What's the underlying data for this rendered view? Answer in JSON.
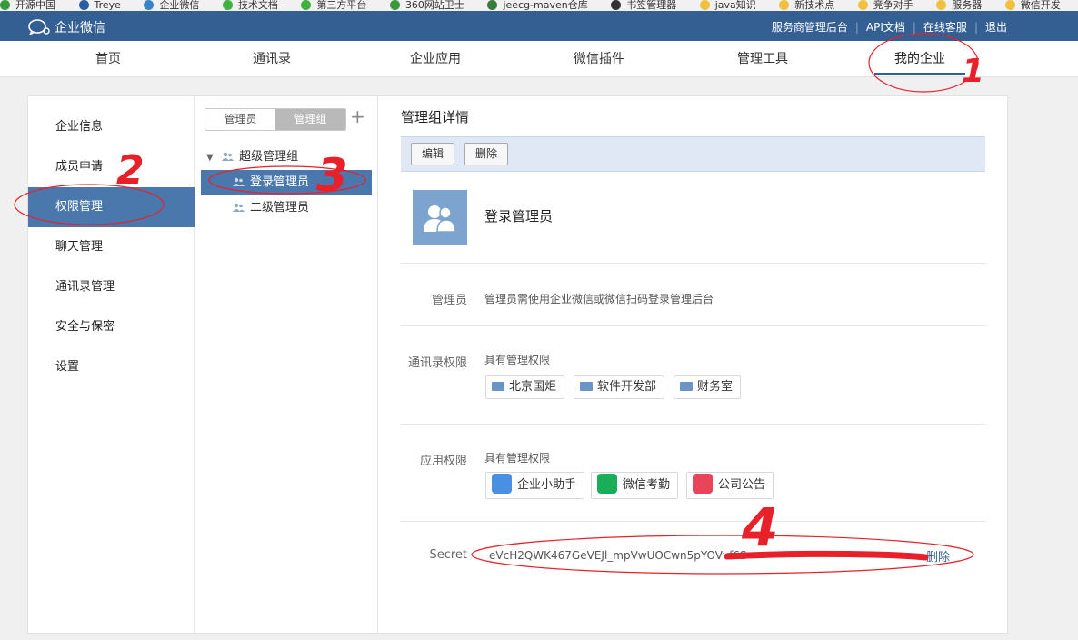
{
  "bookmarks": [
    {
      "label": "开源中国",
      "color": "#3a9a3a"
    },
    {
      "label": "Treye",
      "color": "#2c5ca3"
    },
    {
      "label": "企业微信",
      "color": "#3b83c6"
    },
    {
      "label": "技术文档",
      "color": "#41b03f"
    },
    {
      "label": "第三方平台",
      "color": "#41b03f"
    },
    {
      "label": "360网站卫士",
      "color": "#3a9a3a"
    },
    {
      "label": "jeecg-maven仓库",
      "color": "#3a7a3a"
    },
    {
      "label": "书签管理器",
      "color": "#333333"
    },
    {
      "label": "java知识",
      "color": "#f0c040"
    },
    {
      "label": "新技术点",
      "color": "#f0c040"
    },
    {
      "label": "竞争对手",
      "color": "#f0c040"
    },
    {
      "label": "服务器",
      "color": "#f0c040"
    },
    {
      "label": "微信开发",
      "color": "#f0c040"
    }
  ],
  "header": {
    "brand": "企业微信",
    "links": [
      "服务商管理后台",
      "API文档",
      "在线客服",
      "退出"
    ]
  },
  "nav": {
    "items": [
      "首页",
      "通讯录",
      "企业应用",
      "微信插件",
      "管理工具",
      "我的企业"
    ],
    "active": "我的企业"
  },
  "sidebar": {
    "items": [
      "企业信息",
      "成员申请",
      "权限管理",
      "聊天管理",
      "通讯录管理",
      "安全与保密",
      "设置"
    ],
    "active": "权限管理"
  },
  "tree": {
    "tabs": [
      "管理员",
      "管理组"
    ],
    "active_tab": "管理组",
    "add": "+",
    "nodes": [
      "超级管理组",
      "登录管理员",
      "二级管理员"
    ],
    "selected": "登录管理员"
  },
  "detail": {
    "title": "管理组详情",
    "edit_label": "编辑",
    "delete_label": "删除",
    "name": "登录管理员",
    "admin_label": "管理员",
    "admin_text": "管理员需使用企业微信或微信扫码登录管理后台",
    "contacts_label": "通讯录权限",
    "contacts_note": "具有管理权限",
    "contacts": [
      "北京国炬",
      "软件开发部",
      "财务室"
    ],
    "apps_label": "应用权限",
    "apps_note": "具有管理权限",
    "apps": [
      {
        "name": "企业小助手",
        "color": "#4a90e2"
      },
      {
        "name": "微信考勤",
        "color": "#1aad5a"
      },
      {
        "name": "公司公告",
        "color": "#e8445a"
      }
    ],
    "secret_label": "Secret",
    "secret_value": "eVcH2QWK467GeVEJl_mpVwUOCwn5pYOVvf6S",
    "secret_delete": "删除"
  },
  "annotations": {
    "marks": [
      "1",
      "2",
      "3",
      "4"
    ],
    "color": "#e8202a"
  }
}
